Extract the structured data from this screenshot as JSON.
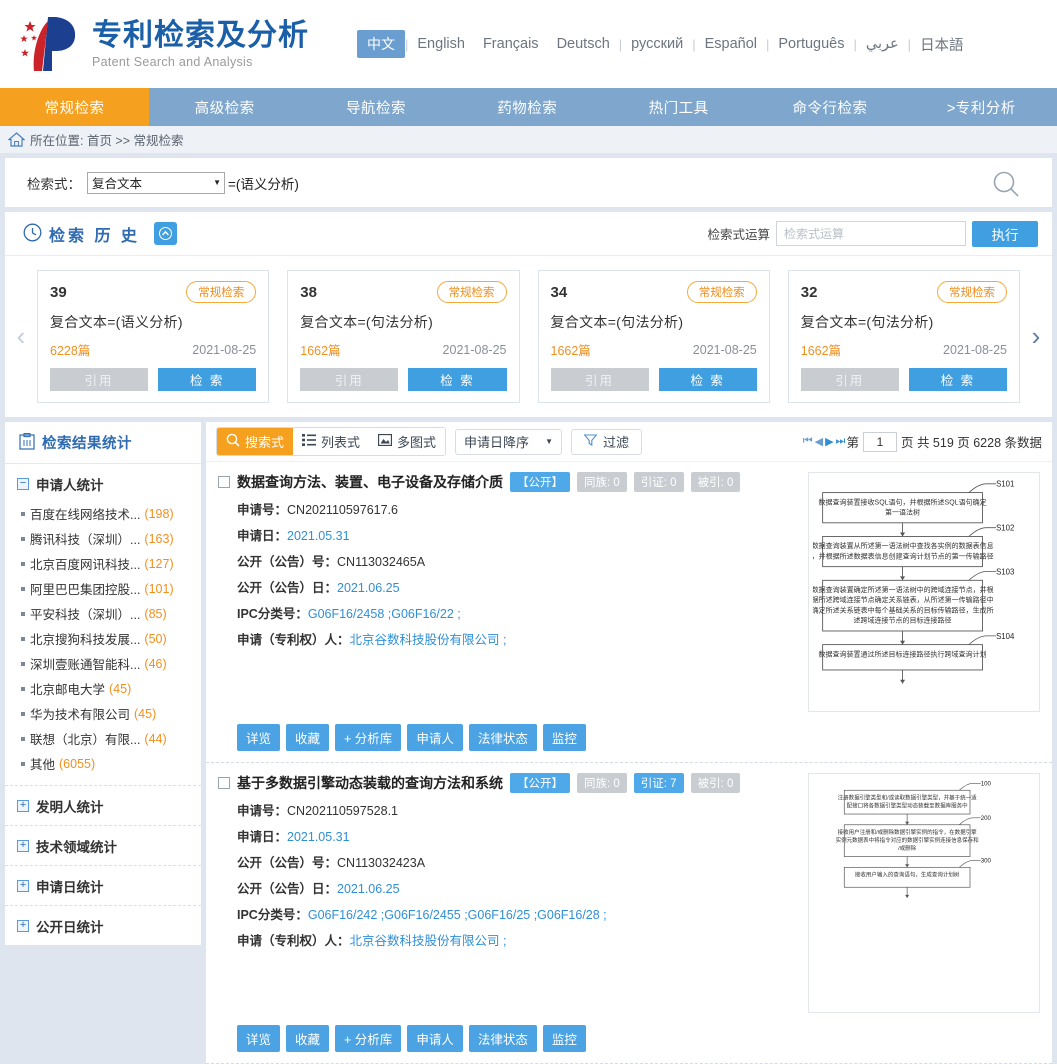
{
  "header": {
    "brand_cn": "专利检索及分析",
    "brand_en": "Patent Search and Analysis",
    "languages": [
      {
        "label": "中文",
        "active": true
      },
      {
        "label": "English",
        "active": false
      },
      {
        "label": "Français",
        "active": false
      },
      {
        "label": "Deutsch",
        "active": false
      },
      {
        "label": "русский",
        "active": false
      },
      {
        "label": "Español",
        "active": false
      },
      {
        "label": "Português",
        "active": false
      },
      {
        "label": "عربي",
        "active": false
      },
      {
        "label": "日本語",
        "active": false
      }
    ]
  },
  "mainnav": [
    {
      "label": "常规检索",
      "active": true
    },
    {
      "label": "高级检索",
      "active": false
    },
    {
      "label": "导航检索",
      "active": false
    },
    {
      "label": "药物检索",
      "active": false
    },
    {
      "label": "热门工具",
      "active": false
    },
    {
      "label": "命令行检索",
      "active": false
    },
    {
      "label": ">专利分析",
      "active": false
    }
  ],
  "breadcrumb": {
    "text": "所在位置: 首页 >> 常规检索"
  },
  "searchbar": {
    "label": "检索式：",
    "select_value": "复合文本",
    "expression": "=(语义分析)"
  },
  "history": {
    "title": "检索 历 史",
    "operation_label": "检索式运算",
    "operation_placeholder": "检索式运算",
    "execute_label": "执行",
    "prev_arrow": "‹",
    "next_arrow": "›",
    "cite_label": "引用",
    "search_label": "检 索",
    "cards": [
      {
        "id": "39",
        "tag": "常规检索",
        "expr": "复合文本=(语义分析)",
        "count": "6228篇",
        "date": "2021-08-25"
      },
      {
        "id": "38",
        "tag": "常规检索",
        "expr": "复合文本=(句法分析)",
        "count": "1662篇",
        "date": "2021-08-25"
      },
      {
        "id": "34",
        "tag": "常规检索",
        "expr": "复合文本=(句法分析)",
        "count": "1662篇",
        "date": "2021-08-25"
      },
      {
        "id": "32",
        "tag": "常规检索",
        "expr": "复合文本=(句法分析)",
        "count": "1662篇",
        "date": "2021-08-25"
      }
    ]
  },
  "sidebar": {
    "title": "检索结果统计",
    "groups": [
      {
        "title": "申请人统计",
        "expanded": true,
        "toggle": "−",
        "items": [
          {
            "label": "百度在线网络技术...",
            "count": "(198)"
          },
          {
            "label": "腾讯科技（深圳）...",
            "count": "(163)"
          },
          {
            "label": "北京百度网讯科技...",
            "count": "(127)"
          },
          {
            "label": "阿里巴巴集团控股...",
            "count": "(101)"
          },
          {
            "label": "平安科技（深圳）...",
            "count": "(85)"
          },
          {
            "label": "北京搜狗科技发展...",
            "count": "(50)"
          },
          {
            "label": "深圳壹账通智能科...",
            "count": "(46)"
          },
          {
            "label": "北京邮电大学",
            "count": "(45)"
          },
          {
            "label": "华为技术有限公司",
            "count": "(45)"
          },
          {
            "label": "联想（北京）有限...",
            "count": "(44)"
          },
          {
            "label": "其他",
            "count": "(6055)"
          }
        ]
      },
      {
        "title": "发明人统计",
        "expanded": false,
        "toggle": "+",
        "items": []
      },
      {
        "title": "技术领域统计",
        "expanded": false,
        "toggle": "+",
        "items": []
      },
      {
        "title": "申请日统计",
        "expanded": false,
        "toggle": "+",
        "items": []
      },
      {
        "title": "公开日统计",
        "expanded": false,
        "toggle": "+",
        "items": []
      }
    ]
  },
  "toolbar": {
    "views": [
      {
        "label": "搜索式",
        "icon": "search-mode-icon",
        "active": true
      },
      {
        "label": "列表式",
        "icon": "list-mode-icon",
        "active": false
      },
      {
        "label": "多图式",
        "icon": "grid-mode-icon",
        "active": false
      }
    ],
    "sort_value": "申请日降序",
    "filter_label": "过滤",
    "pager": {
      "first": "⏮",
      "prev": "◀",
      "next": "▶",
      "last": "⏭",
      "prefix": "第",
      "page": "1",
      "suffix": "页 共 519 页 6228 条数据"
    }
  },
  "results": {
    "field_labels": {
      "app_no": "申请号：",
      "app_date": "申请日：",
      "pub_no": "公开（公告）号：",
      "pub_date": "公开（公告）日：",
      "ipc": "IPC分类号：",
      "applicant": "申请（专利权）人："
    },
    "actions": [
      "详览",
      "收藏",
      "+ 分析库",
      "申请人",
      "法律状态",
      "监控"
    ],
    "items": [
      {
        "title": "数据查询方法、装置、电子设备及存储介质",
        "status_badge": "【公开】",
        "badges": [
          {
            "label": "同族: 0",
            "highlight": false
          },
          {
            "label": "引证: 0",
            "highlight": false
          },
          {
            "label": "被引: 0",
            "highlight": false
          }
        ],
        "app_no": "CN202110597617.6",
        "app_date": "2021.05.31",
        "pub_no": "CN113032465A",
        "pub_date": "2021.06.25",
        "ipc": "G06F16/2458 ;G06F16/22 ;",
        "applicant": "北京谷数科技股份有限公司 ;",
        "figure": {
          "steps": [
            {
              "tag": "S101",
              "text": "数据查询装置接收SQL语句，并根据所述SQL语句确定第一语法树"
            },
            {
              "tag": "S102",
              "text": "数据查询装置从所述第一语法树中查找各实例的数据表信息，并根据所述数据表信息创建查询计划节点的第一传输路径"
            },
            {
              "tag": "S103",
              "text": "数据查询装置确定所述第一语法树中的跨域连接节点，并根据所述跨域连接节点确定关系链表，从所述第一传输路径中确定所述关系链表中每个基础关系的目标传输路径，生成所述跨域连接节点的目标连接路径"
            },
            {
              "tag": "S104",
              "text": "数据查询装置通过所述目标连接路径执行跨域查询计划"
            }
          ]
        }
      },
      {
        "title": "基于多数据引擎动态装载的查询方法和系统",
        "status_badge": "【公开】",
        "badges": [
          {
            "label": "同族: 0",
            "highlight": false
          },
          {
            "label": "引证: 7",
            "highlight": true
          },
          {
            "label": "被引: 0",
            "highlight": false
          }
        ],
        "app_no": "CN202110597528.1",
        "app_date": "2021.05.31",
        "pub_no": "CN113032423A",
        "pub_date": "2021.06.25",
        "ipc": "G06F16/242 ;G06F16/2455 ;G06F16/25 ;G06F16/28 ;",
        "applicant": "北京谷数科技股份有限公司 ;",
        "figure": {
          "steps": [
            {
              "tag": "100",
              "text": "注册数据引擎类型和/或读取数据引擎类型，并基于统一适配接口将各数据引擎类型动态装载至数据库服务中"
            },
            {
              "tag": "200",
              "text": "接收用户注册和/或删除数据引擎实例的指令，在数据引擎实例元数据表中将指令对应的数据引擎实例连接信息保存和/或删除"
            },
            {
              "tag": "300",
              "text": "接收用户输入的查询语句，生成查询计划树"
            }
          ]
        }
      }
    ]
  }
}
